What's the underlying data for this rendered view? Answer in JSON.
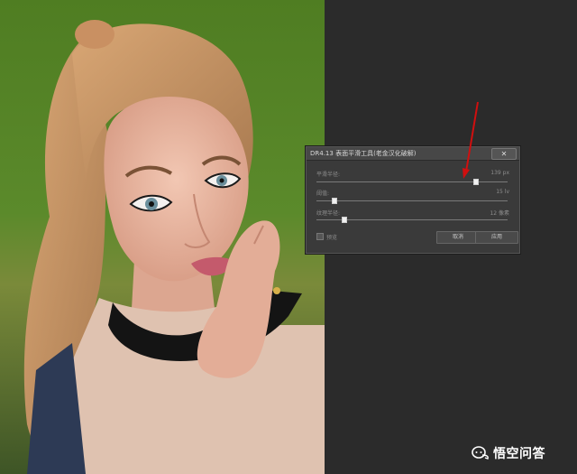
{
  "dialog": {
    "title": "DR4.13 表面平滑工具(老金汉化破解)",
    "close_label": "✕",
    "sliders": [
      {
        "label": "平滑半径:",
        "value": "139 px",
        "level": 0.83
      },
      {
        "label": "阈值:",
        "value": "15 lv",
        "level": 0.09
      },
      {
        "label": "纹理半径:",
        "value": "12 像素",
        "level": 0.14
      }
    ],
    "preview_label": "预览",
    "cancel_label": "取消",
    "apply_label": "应用"
  },
  "watermark": {
    "text": "悟空问答",
    "icon": "chat-bubbles-icon"
  },
  "colors": {
    "workspace": "#2b2b2b",
    "arrow": "#d10f0f"
  }
}
